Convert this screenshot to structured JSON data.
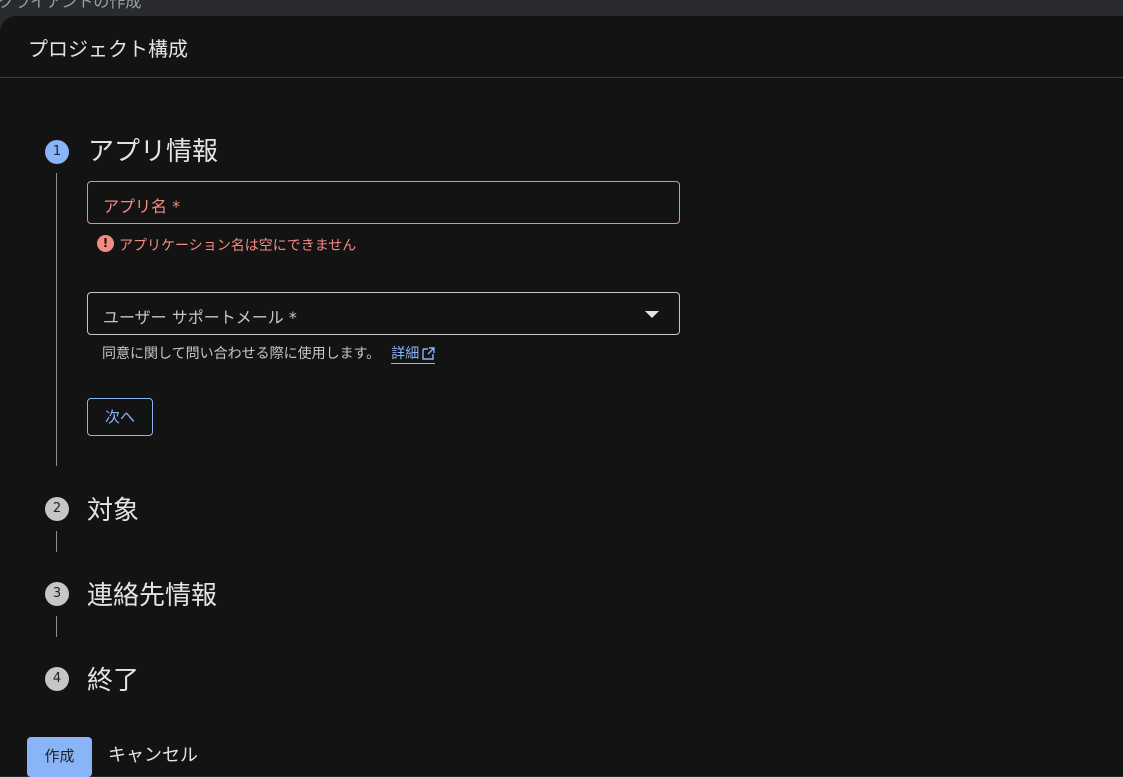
{
  "background_title": "クライアントの作成",
  "panel": {
    "title": "プロジェクト構成"
  },
  "steps": [
    {
      "number": "1",
      "title": "アプリ情報",
      "state": "active"
    },
    {
      "number": "2",
      "title": "対象",
      "state": "inactive"
    },
    {
      "number": "3",
      "title": "連絡先情報",
      "state": "inactive"
    },
    {
      "number": "4",
      "title": "終了",
      "state": "inactive"
    }
  ],
  "app_name_field": {
    "label": "アプリ名 *",
    "value": "",
    "error": "アプリケーション名は空にできません"
  },
  "support_email_field": {
    "label": "ユーザー サポートメール *",
    "value": "",
    "helper_text": "同意に関して問い合わせる際に使用します。",
    "helper_link": "詳細"
  },
  "buttons": {
    "next": "次へ",
    "create": "作成",
    "cancel": "キャンセル"
  },
  "icons": {
    "error": "error-circle-icon",
    "dropdown": "arrow-drop-down-icon",
    "external_link": "open-in-new-icon"
  },
  "colors": {
    "accent": "#8ab4f8",
    "error": "#f28b82",
    "background": "#131314"
  }
}
